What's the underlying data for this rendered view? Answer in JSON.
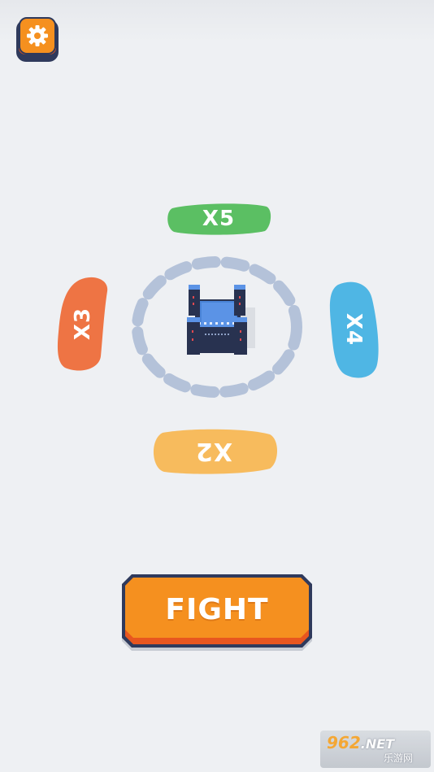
{
  "settings": {
    "icon": "gear-icon"
  },
  "multipliers": {
    "top": {
      "label": "X5",
      "color": "#5bbf63"
    },
    "left": {
      "label": "X3",
      "color": "#ee7444"
    },
    "right": {
      "label": "X4",
      "color": "#4fb6e4"
    },
    "bottom": {
      "label": "X2",
      "color": "#f7bb5d"
    }
  },
  "fight_button": {
    "label": "FIGHT",
    "color": "#f5901f"
  },
  "watermark": {
    "brand_digits": "962",
    "brand_suffix": ".NET",
    "subtitle": "乐游网"
  },
  "colors": {
    "background": "#eef0f3",
    "ring": "#b4c2d9",
    "outline": "#2f3a5c"
  }
}
